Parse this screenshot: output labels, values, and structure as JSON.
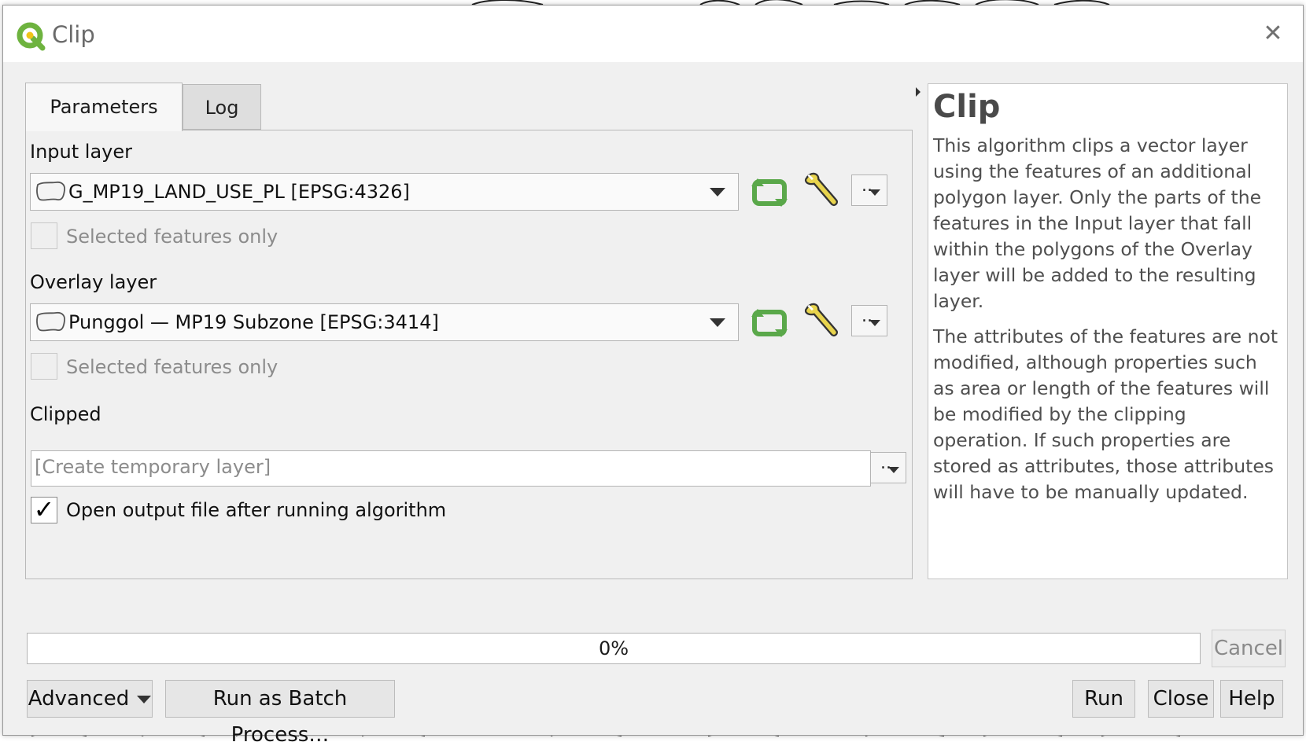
{
  "window": {
    "title": "Clip",
    "close_glyph": "✕"
  },
  "tabs": [
    {
      "label": "Parameters",
      "active": true
    },
    {
      "label": "Log",
      "active": false
    }
  ],
  "params": {
    "input_layer": {
      "label": "Input layer",
      "value": "G_MP19_LAND_USE_PL [EPSG:4326]",
      "selected_only_label": "Selected features only",
      "selected_only_checked": false,
      "dots_label": ".."
    },
    "overlay_layer": {
      "label": "Overlay layer",
      "value": "Punggol — MP19 Subzone [EPSG:3414]",
      "selected_only_label": "Selected features only",
      "selected_only_checked": false,
      "dots_label": ".."
    },
    "clipped": {
      "label": "Clipped",
      "placeholder": "[Create temporary layer]",
      "dots_label": ".."
    },
    "open_output": {
      "label": "Open output file after running algorithm",
      "checked": true,
      "check_glyph": "✓"
    }
  },
  "help": {
    "title": "Clip",
    "paragraphs": [
      "This algorithm clips a vector layer using the features of an additional polygon layer. Only the parts of the features in the Input layer that fall within the polygons of the Overlay layer will be added to the resulting layer.",
      "The attributes of the features are not modified, although properties such as area or length of the features will be modified by the clipping operation. If such properties are stored as attributes, those attributes will have to be manually updated."
    ]
  },
  "progress": {
    "text": "0%",
    "value": 0
  },
  "buttons": {
    "cancel": "Cancel",
    "advanced": "Advanced",
    "batch": "Run as Batch Process…",
    "run": "Run",
    "close": "Close",
    "help": "Help"
  },
  "colors": {
    "qgis_green": "#6eb33f",
    "qgis_yellow": "#f0c419",
    "iterate_green": "#5aa84a",
    "wrench_yellow": "#e8d44d"
  },
  "icons": {
    "app_logo": "qgis-logo-icon",
    "layer": "polygon-layer-icon",
    "iterate": "iterate-icon",
    "advanced": "wrench-icon"
  }
}
